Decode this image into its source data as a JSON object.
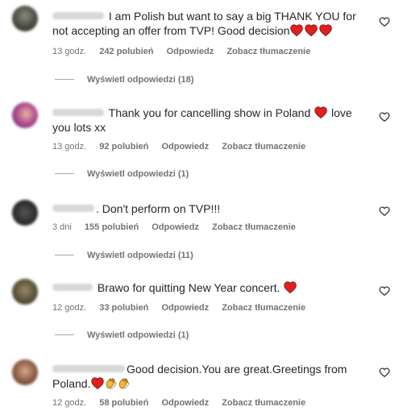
{
  "comments": [
    {
      "text": "I am Polish but want to say a big THANK YOU for not accepting an offer from TVP! Good decision",
      "hearts_after": 3,
      "time": "13 godz.",
      "likes": "242 polubień",
      "reply": "Odpowiedz",
      "translate": "Zobacz tłumaczenie",
      "view_replies": "Wyświetl odpowiedzi (18)"
    },
    {
      "text_before": "Thank you for cancelling show in Poland",
      "text_after": "love you lots xx",
      "time": "13 godz.",
      "likes": "92 polubień",
      "reply": "Odpowiedz",
      "translate": "Zobacz tłumaczenie",
      "view_replies": "Wyświetl odpowiedzi (1)"
    },
    {
      "text": ". Don't perform on TVP!!!",
      "time": "3 dni",
      "likes": "155 polubień",
      "reply": "Odpowiedz",
      "translate": "Zobacz tłumaczenie",
      "view_replies": "Wyświetl odpowiedzi (11)"
    },
    {
      "text": "Brawo for quitting New Year concert.",
      "hearts_after": 1,
      "time": "12 godz.",
      "likes": "33 polubień",
      "reply": "Odpowiedz",
      "translate": "Zobacz tłumaczenie",
      "view_replies": "Wyświetl odpowiedzi (1)"
    },
    {
      "text": "Good decision.You are great.Greetings from Poland.",
      "time": "12 godz.",
      "likes": "58 polubień",
      "reply": "Odpowiedz",
      "translate": "Zobacz tłumaczenie"
    }
  ],
  "icons": {
    "like": "heart-outline-icon",
    "emoji_heart": "red-heart-emoji",
    "emoji_clap": "clapping-hands-emoji"
  },
  "colors": {
    "text": "#262626",
    "secondary": "#737373",
    "heart_red": "#e0201f",
    "clap_yellow": "#f5b82e"
  }
}
